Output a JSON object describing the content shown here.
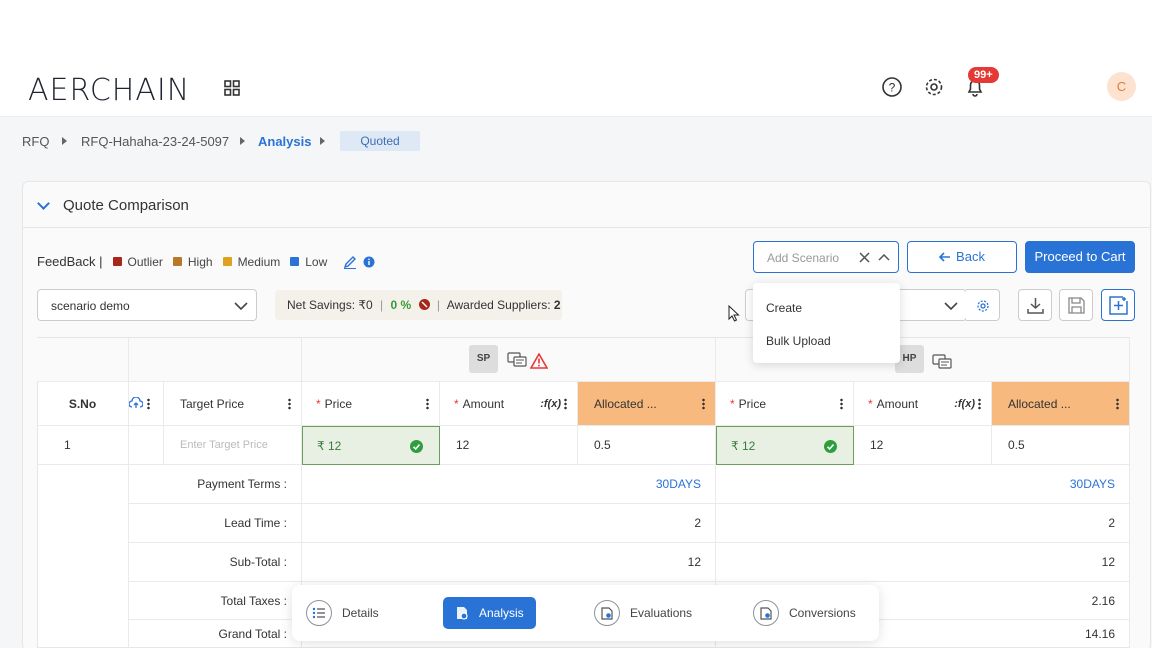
{
  "app": {
    "logo": "AERCHAIN",
    "notification_count": "99+",
    "avatar_initial": "C"
  },
  "breadcrumb": {
    "items": [
      "RFQ",
      "RFQ-Hahaha-23-24-5097",
      "Analysis"
    ],
    "status": "Quoted"
  },
  "section": {
    "title": "Quote Comparison"
  },
  "feedback": {
    "label": "FeedBack |",
    "legend": [
      {
        "label": "Outlier",
        "color": "#a5281b"
      },
      {
        "label": "High",
        "color": "#b8782a"
      },
      {
        "label": "Medium",
        "color": "#e0a020"
      },
      {
        "label": "Low",
        "color": "#2a73d6"
      }
    ]
  },
  "toolbar": {
    "add_scenario_placeholder": "Add Scenario",
    "back_label": "Back",
    "cart_label": "Proceed to Cart"
  },
  "scenario": {
    "selected": "scenario demo"
  },
  "savings": {
    "net_label": "Net Savings:",
    "net_value": "₹0",
    "percent": "0 %",
    "awarded_label": "Awarded Suppliers:",
    "awarded_value": "2"
  },
  "dropdown": {
    "items": [
      "Create",
      "Bulk Upload"
    ]
  },
  "suppliers": [
    "SP",
    "HP"
  ],
  "table": {
    "headers": {
      "sno": "S.No",
      "target": "Target Price",
      "price": "Price",
      "amount": "Amount",
      "fx": ":f(x)",
      "allocated": "Allocated ..."
    },
    "row": {
      "sno": "1",
      "target_placeholder": "Enter Target Price",
      "sp_price": "₹ 12",
      "sp_amount": "12",
      "sp_alloc": "0.5",
      "hp_price": "₹ 12",
      "hp_amount": "12",
      "hp_alloc": "0.5"
    },
    "summary": [
      {
        "label": "Payment Terms :",
        "sp": "30DAYS",
        "hp": "30DAYS"
      },
      {
        "label": "Lead Time :",
        "sp": "2",
        "hp": "2"
      },
      {
        "label": "Sub-Total :",
        "sp": "12",
        "hp": "12"
      },
      {
        "label": "Total Taxes :",
        "sp": "",
        "hp": "2.16"
      },
      {
        "label": "Grand Total :",
        "sp": "",
        "hp": "14.16"
      }
    ]
  },
  "bottom_nav": {
    "items": [
      "Details",
      "Analysis",
      "Evaluations",
      "Conversions"
    ],
    "active": "Analysis"
  }
}
